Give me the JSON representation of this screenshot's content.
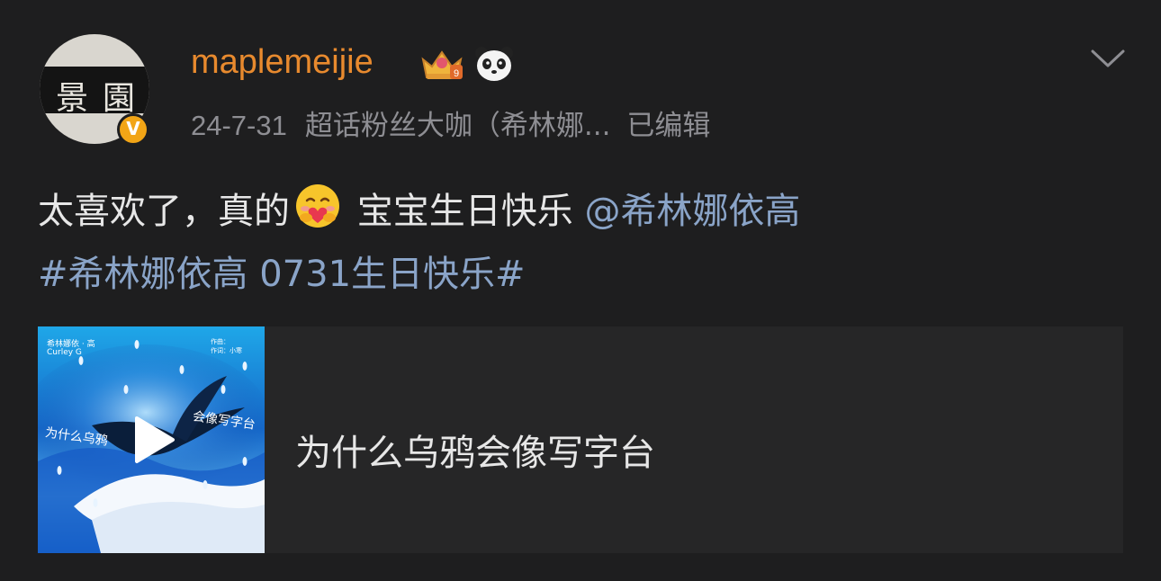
{
  "author": {
    "username": "maplemeijie",
    "avatar_text": [
      "景",
      "園"
    ],
    "verified_badge": "V",
    "badges": [
      "crown-badge-icon",
      "panda-badge-icon"
    ]
  },
  "meta": {
    "date": "24-7-31",
    "source": "超话粉丝大咖（希林娜...",
    "edited": "已编辑"
  },
  "content": {
    "text_part1": "太喜欢了，真的",
    "emoji": "hug-emoji",
    "text_part2": " 宝宝生日快乐",
    "mention": "@希林娜依高",
    "hashtag": "#希林娜依高 0731生日快乐#"
  },
  "music_card": {
    "song_title": "为什么乌鸦会像写字台",
    "cover": {
      "artist": "希林娜依 · 高",
      "artist_en": "Curley G",
      "credit_composer": "作曲：",
      "credit_lyricist": "作词：小寒",
      "title_left": "为什么乌鸦",
      "title_right": "会像写字台"
    }
  },
  "colors": {
    "background": "#1e1e1f",
    "username": "#e88a2e",
    "link": "#8aa4c8",
    "meta": "#8e8e93",
    "verified": "#f2a516"
  }
}
